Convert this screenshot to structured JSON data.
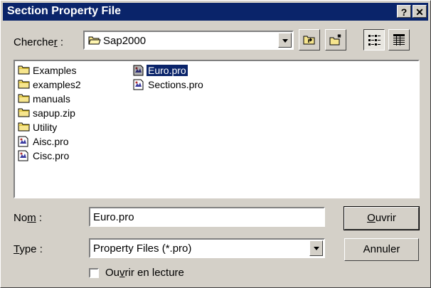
{
  "window": {
    "title": "Section Property File",
    "help_btn": "?",
    "close_btn": "✕"
  },
  "lookin": {
    "label_pre": "Cherche",
    "label_u": "r",
    "label_post": " :",
    "value": "Sap2000"
  },
  "toolbar": {
    "up_icon": "up-folder-icon",
    "newfolder_icon": "new-folder-icon",
    "list_icon": "list-view-icon",
    "details_icon": "details-view-icon"
  },
  "files": [
    {
      "name": "Examples",
      "type": "folder"
    },
    {
      "name": "examples2",
      "type": "folder"
    },
    {
      "name": "manuals",
      "type": "folder"
    },
    {
      "name": "sapup.zip",
      "type": "folder"
    },
    {
      "name": "Utility",
      "type": "folder"
    },
    {
      "name": "Aisc.pro",
      "type": "file"
    },
    {
      "name": "Cisc.pro",
      "type": "file"
    },
    {
      "name": "Euro.pro",
      "type": "file",
      "selected": true
    },
    {
      "name": "Sections.pro",
      "type": "file"
    }
  ],
  "name_field": {
    "label_pre": "No",
    "label_u": "m",
    "label_post": " :",
    "value": "Euro.pro"
  },
  "type_field": {
    "label_u": "T",
    "label_post": "ype :",
    "value": "Property Files (*.pro)"
  },
  "buttons": {
    "open_u": "O",
    "open_rest": "uvrir",
    "cancel": "Annuler"
  },
  "readonly": {
    "label_pre": "Ou",
    "label_u": "v",
    "label_post": "rir en lecture"
  }
}
